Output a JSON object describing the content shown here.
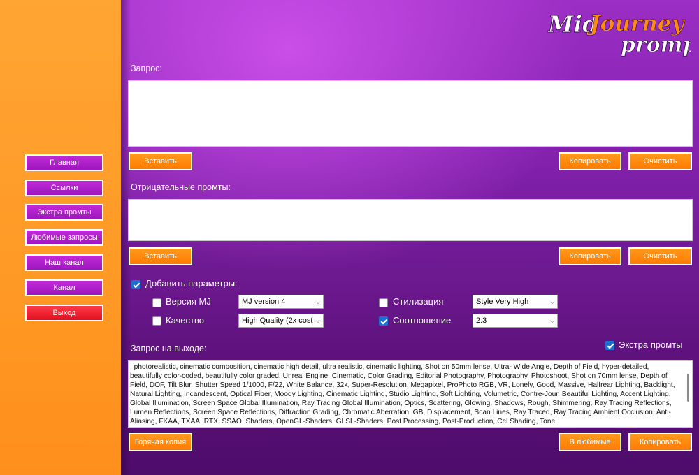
{
  "nav": {
    "items": [
      {
        "label": "Главная"
      },
      {
        "label": "Ссылки"
      },
      {
        "label": "Экстра промты"
      },
      {
        "label": "Любимые запросы"
      },
      {
        "label": "Наш канал"
      },
      {
        "label": "Канал"
      },
      {
        "label": "Выход"
      }
    ]
  },
  "logo": {
    "line1a": "Mid",
    "line1b": "Journey",
    "line2": "prompt"
  },
  "query": {
    "label": "Запрос:",
    "value": "",
    "paste": "Вставить",
    "copy": "Копировать",
    "clear": "Очистить"
  },
  "negative": {
    "label": "Отрицательные промты:",
    "value": "",
    "paste": "Вставить",
    "copy": "Копировать",
    "clear": "Очистить"
  },
  "params": {
    "add_label": "Добавить параметры:",
    "add_checked": true,
    "version": {
      "label": "Версия MJ",
      "checked": false,
      "value": "MJ version 4"
    },
    "quality": {
      "label": "Качество",
      "checked": false,
      "value": "High Quality (2x cost)"
    },
    "stylize": {
      "label": "Стилизация",
      "checked": false,
      "value": "Style Very High"
    },
    "aspect": {
      "label": "Соотношение",
      "checked": true,
      "value": "2:3"
    }
  },
  "output": {
    "label": "Запрос на выходе:",
    "extra_label": "Экстра промты",
    "extra_checked": true,
    "text": ", photorealistic, cinematic composition, cinematic high detail, ultra realistic, cinematic lighting, Shot on 50mm lense, Ultra- Wide Angle, Depth of Field, hyper-detailed, beautifully color-coded, beautifully color graded, Unreal Engine, Cinematic, Color Grading, Editorial Photography, Photography, Photoshoot, Shot on 70mm lense, Depth of Field, DOF, Tilt Blur, Shutter Speed 1/1000, F/22, White Balance, 32k, Super-Resolution, Megapixel, ProPhoto RGB, VR, Lonely, Good, Massive, Halfrear Lighting, Backlight, Natural Lighting, Incandescent, Optical Fiber, Moody Lighting, Cinematic Lighting, Studio Lighting, Soft Lighting, Volumetric, Contre-Jour, Beautiful Lighting, Accent Lighting, Global Illumination, Screen Space Global Illumination, Ray Tracing Global Illumination, Optics, Scattering, Glowing, Shadows, Rough, Shimmering, Ray Tracing Reflections, Lumen Reflections, Screen Space Reflections, Diffraction Grading, Chromatic Aberration, GB, Displacement, Scan Lines, Ray Traced, Ray Tracing Ambient Occlusion, Anti-Aliasing, FKAA, TXAA, RTX, SSAO, Shaders, OpenGL-Shaders, GLSL-Shaders, Post Processing, Post-Production, Cel Shading, Tone",
    "hot_copy": "Горячая копия",
    "to_favorites": "В любимые",
    "copy": "Копировать"
  }
}
